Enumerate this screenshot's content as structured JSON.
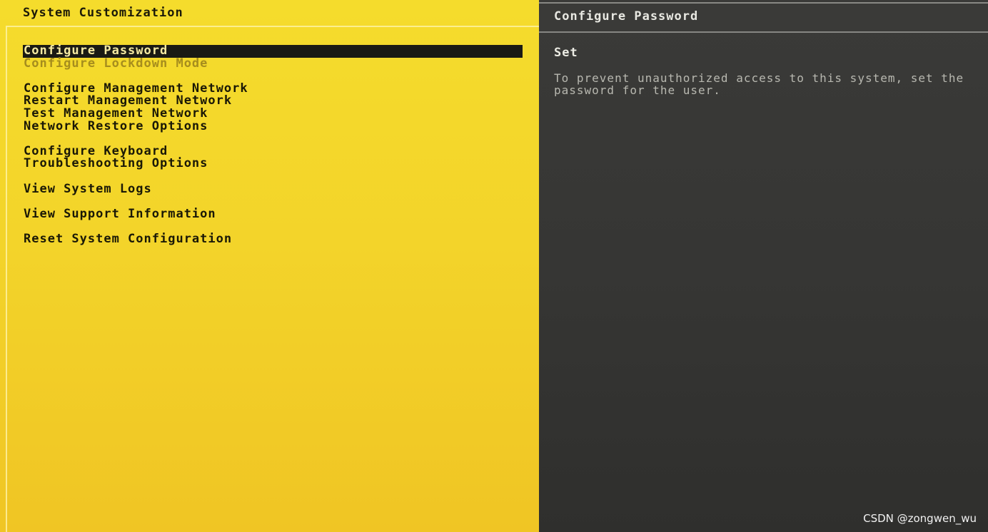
{
  "left_panel": {
    "title": "System Customization",
    "menu_groups": [
      [
        "Configure Password",
        "Configure Lockdown Mode"
      ],
      [
        "Configure Management Network",
        "Restart Management Network",
        "Test Management Network",
        "Network Restore Options"
      ],
      [
        "Configure Keyboard",
        "Troubleshooting Options"
      ],
      [
        "View System Logs"
      ],
      [
        "View Support Information"
      ],
      [
        "Reset System Configuration"
      ]
    ],
    "selected_item": "Configure Password",
    "dimmed_item": "Configure Lockdown Mode"
  },
  "right_panel": {
    "title": "Configure Password",
    "value": "Set",
    "description_lines": [
      "To prevent unauthorized access to this system, set the",
      "password for the user."
    ]
  },
  "watermark": "CSDN @zongwen_wu",
  "colors": {
    "left_background": "#f3d42a",
    "right_background": "#363634",
    "selected_background": "#1a1a14",
    "dim_text": "#a68d1d"
  }
}
